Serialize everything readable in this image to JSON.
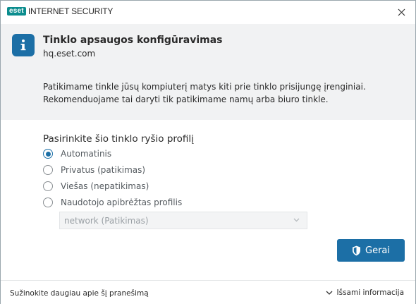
{
  "window": {
    "logo_badge": "eset",
    "product_name": "INTERNET SECURITY"
  },
  "header": {
    "title": "Tinklo apsaugos konfigūravimas",
    "network": "hq.eset.com",
    "description_line1": "Patikimame tinkle jūsų kompiuterį matys kiti prie tinklo prisijungę įrenginiai.",
    "description_line2": "Rekomenduojame tai daryti tik patikimame namų arba biuro tinkle."
  },
  "profile": {
    "title": "Pasirinkite šio tinklo ryšio profilį",
    "options": [
      {
        "label": "Automatinis",
        "selected": true
      },
      {
        "label": "Privatus (patikimas)",
        "selected": false
      },
      {
        "label": "Viešas (nepatikimas)",
        "selected": false
      },
      {
        "label": "Naudotojo apibrėžtas profilis",
        "selected": false
      }
    ],
    "custom_select_value": "network (Patikimas)"
  },
  "buttons": {
    "ok_label": "Gerai"
  },
  "footer": {
    "learn_more": "Sužinokite daugiau apie šį pranešimą",
    "details": "Išsami informacija"
  },
  "colors": {
    "accent": "#1c6fa6",
    "brand": "#0b8d8e",
    "header_bg": "#f1f2f3"
  },
  "icons": [
    "info-icon",
    "close-icon",
    "shield-icon",
    "chevron-down-icon"
  ]
}
